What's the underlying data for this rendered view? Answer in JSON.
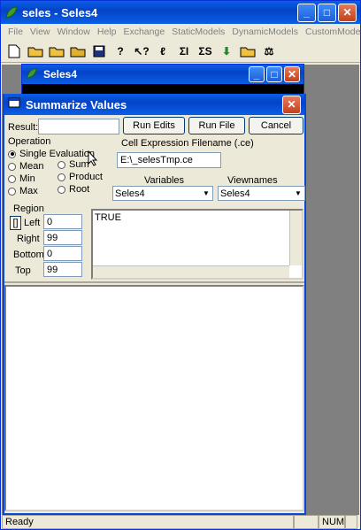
{
  "main_window": {
    "title": "seles - Seles4"
  },
  "menu": [
    "File",
    "View",
    "Window",
    "Help",
    "Exchange",
    "StaticModels",
    "DynamicModels",
    "CustomModels"
  ],
  "child_window": {
    "title": "Seles4"
  },
  "dialog": {
    "title": "Summarize Values",
    "result_label": "Result:",
    "result_value": "",
    "run_edits": "Run Edits",
    "run_file": "Run File",
    "cancel": "Cancel",
    "operation_label": "Operation",
    "operations": {
      "single": "Single Evaluation",
      "mean": "Mean",
      "min": "Min",
      "max": "Max",
      "sum": "Sum",
      "product": "Product",
      "root": "Root"
    },
    "selected_operation": "Single Evaluation",
    "ce_filename_label": "Cell Expression Filename (.ce)",
    "ce_filename_value": "E:\\_selesTmp.ce",
    "variables_label": "Variables",
    "variables_value": "Seles4",
    "viewnames_label": "Viewnames",
    "viewnames_value": "Seles4",
    "region_label": "Region",
    "region_button": "[]",
    "left_label": "Left",
    "left_value": "0",
    "right_label": "Right",
    "right_value": "99",
    "bottom_label": "Bottom",
    "bottom_value": "0",
    "top_label": "Top",
    "top_value": "99",
    "expression_text": "TRUE",
    "output_text": ""
  },
  "status": {
    "text": "Ready",
    "num": "NUM"
  }
}
